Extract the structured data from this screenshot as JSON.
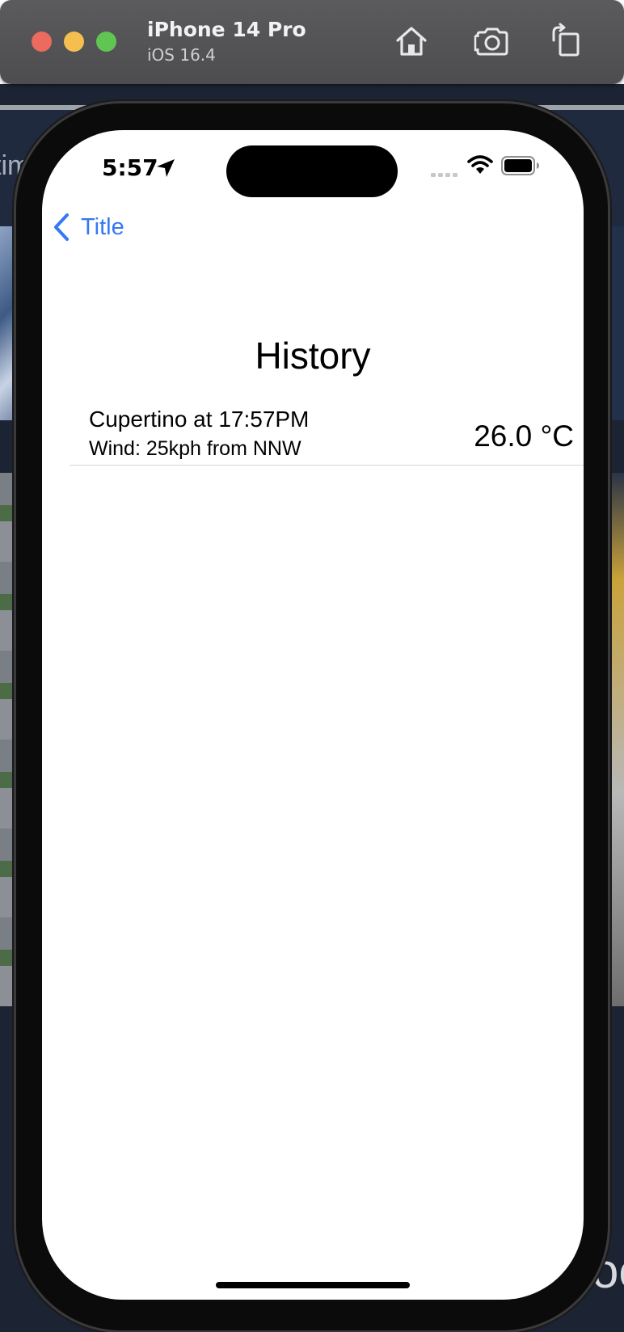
{
  "simulator": {
    "device_name": "iPhone 14 Pro",
    "os_version": "iOS 16.4",
    "toolbar_icons": [
      "home-icon",
      "screenshot-icon",
      "rotate-icon"
    ]
  },
  "background_app": {
    "partial_text_left": "tim",
    "partial_text_right": "oc"
  },
  "status_bar": {
    "time": "5:57",
    "icons": [
      "location-arrow-icon",
      "cellular-signal-icon",
      "wifi-icon",
      "battery-icon"
    ]
  },
  "nav": {
    "back_label": "Title"
  },
  "page": {
    "title": "History"
  },
  "history": [
    {
      "title": "Cupertino at 17:57PM",
      "subtitle": "Wind: 25kph from NNW",
      "temperature": "26.0 °C"
    }
  ],
  "colors": {
    "accent": "#3478f6",
    "toolbar": "#545456",
    "traffic_red": "#ec6a5e",
    "traffic_yellow": "#f4bf4f",
    "traffic_green": "#61c554"
  }
}
